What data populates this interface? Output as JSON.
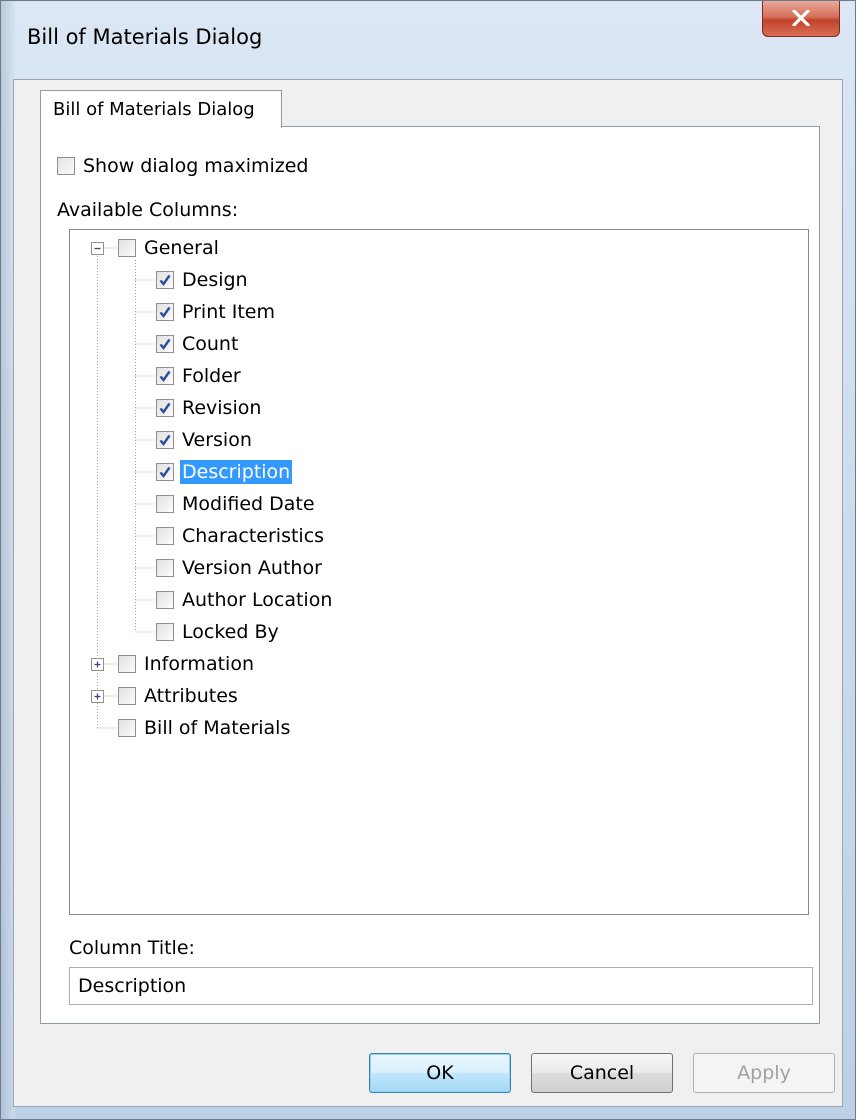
{
  "window": {
    "title": "Bill of Materials Dialog"
  },
  "tab": {
    "label": "Bill of Materials Dialog"
  },
  "options": {
    "show_maximized_label": "Show dialog maximized",
    "show_maximized_checked": false
  },
  "tree": {
    "label": "Available Columns:",
    "groups": [
      {
        "label": "General",
        "expanded": true,
        "checked": false,
        "children": [
          {
            "label": "Design",
            "checked": true
          },
          {
            "label": "Print Item",
            "checked": true
          },
          {
            "label": "Count",
            "checked": true
          },
          {
            "label": "Folder",
            "checked": true
          },
          {
            "label": "Revision",
            "checked": true
          },
          {
            "label": "Version",
            "checked": true
          },
          {
            "label": "Description",
            "checked": true,
            "selected": true
          },
          {
            "label": "Modified Date",
            "checked": false
          },
          {
            "label": "Characteristics",
            "checked": false
          },
          {
            "label": "Version Author",
            "checked": false
          },
          {
            "label": "Author Location",
            "checked": false
          },
          {
            "label": "Locked By",
            "checked": false
          }
        ]
      },
      {
        "label": "Information",
        "expanded": false,
        "checked": false
      },
      {
        "label": "Attributes",
        "expanded": false,
        "checked": false
      },
      {
        "label": "Bill of Materials",
        "expandable": false,
        "checked": false
      }
    ]
  },
  "column_title": {
    "label": "Column Title:",
    "value": "Description"
  },
  "buttons": {
    "ok": "OK",
    "cancel": "Cancel",
    "apply": "Apply"
  },
  "colors": {
    "selection": "#3399ff",
    "close_button": "#c0442b",
    "title_bar": "#dbe7f4"
  },
  "icons": {
    "close": "close-icon",
    "checkmark": "checkmark-icon",
    "expand": "plus-box-icon",
    "collapse": "minus-box-icon"
  }
}
